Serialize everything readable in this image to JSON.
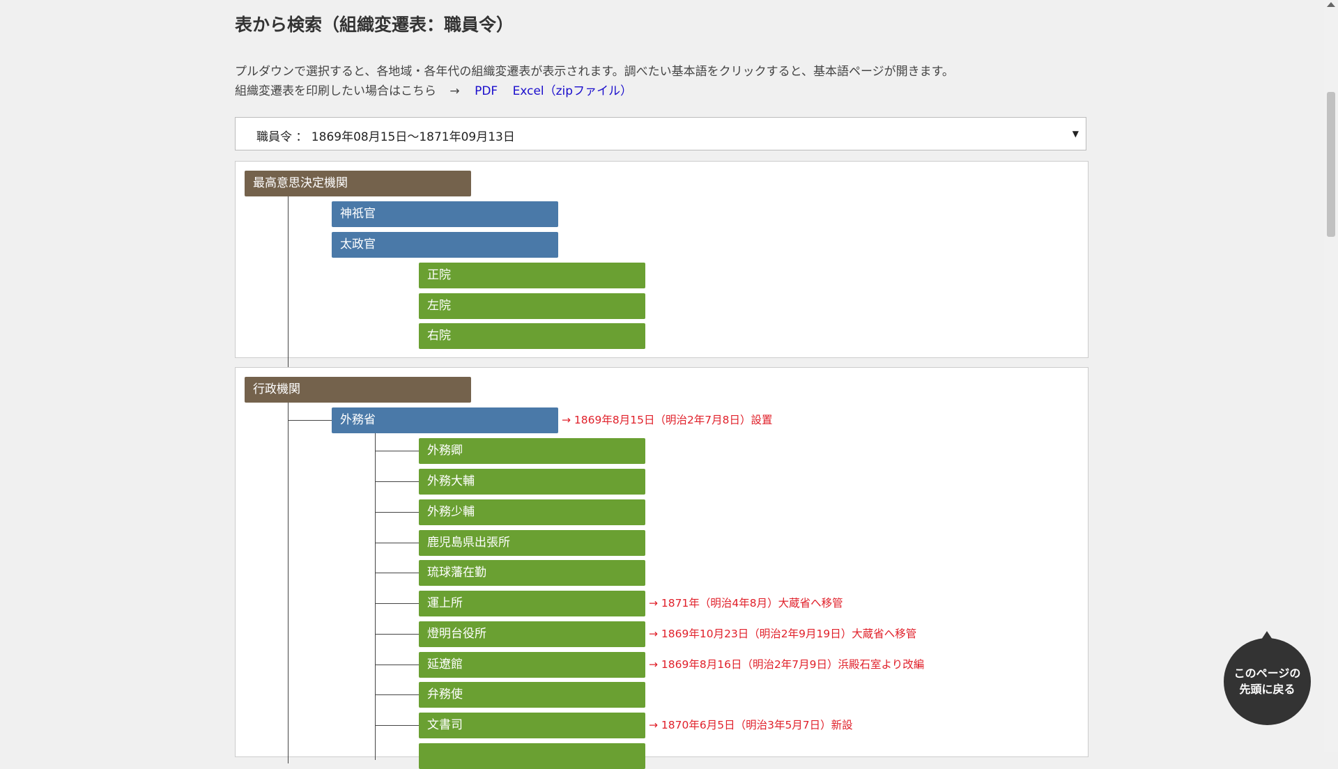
{
  "page": {
    "title": "表から検索（組織変遷表：職員令）",
    "intro": "プルダウンで選択すると、各地域・各年代の組織変遷表が表示されます。調べたい基本語をクリックすると、基本語ページが開きます。",
    "print_text": "組織変遷表を印刷したい場合はこちら",
    "print_arrow": "→",
    "pdf_link": "PDF",
    "excel_link": "Excel（zipファイル）"
  },
  "select": {
    "value": "職員令 ： 1869年08月15日～1871年09月13日"
  },
  "panel1": {
    "root": "最高意思決定機関",
    "l1": [
      "神祇官",
      "太政官"
    ],
    "l2": [
      "正院",
      "左院",
      "右院"
    ]
  },
  "panel2": {
    "root": "行政機関",
    "dept": "外務省",
    "dept_note": "→ 1869年8月15日（明治2年7月8日）設置",
    "items": [
      {
        "label": "外務卿",
        "note": ""
      },
      {
        "label": "外務大輔",
        "note": ""
      },
      {
        "label": "外務少輔",
        "note": ""
      },
      {
        "label": "鹿児島県出張所",
        "note": ""
      },
      {
        "label": "琉球藩在勤",
        "note": ""
      },
      {
        "label": "運上所",
        "note": "→ 1871年（明治4年8月）大蔵省へ移管"
      },
      {
        "label": "燈明台役所",
        "note": "→ 1869年10月23日（明治2年9月19日）大蔵省へ移管"
      },
      {
        "label": "延遼館",
        "note": "→ 1869年8月16日（明治2年7月9日）浜殿石室より改編"
      },
      {
        "label": "弁務使",
        "note": ""
      },
      {
        "label": "文書司",
        "note": "→ 1870年6月5日（明治3年5月7日）新設"
      },
      {
        "label": "",
        "note": ""
      }
    ]
  },
  "back_to_top": {
    "line1": "このページの",
    "line2": "先頭に戻る"
  },
  "colors": {
    "root": "#74624c",
    "level1": "#4a79a8",
    "level2": "#6aa032",
    "note": "#e0202a"
  }
}
